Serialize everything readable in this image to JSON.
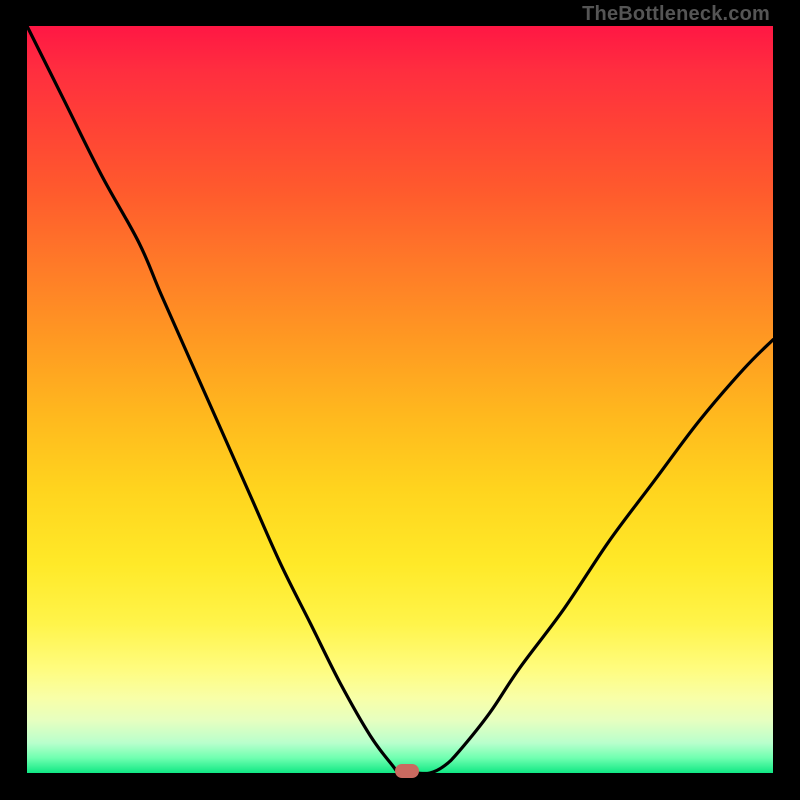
{
  "attribution": "TheBottleneck.com",
  "colors": {
    "frame": "#000000",
    "gradient_top": "#ff1744",
    "gradient_bottom": "#10e884",
    "curve": "#000000",
    "marker": "#c96a60",
    "attribution_text": "#555555"
  },
  "chart_data": {
    "type": "line",
    "title": "",
    "xlabel": "",
    "ylabel": "",
    "x": [
      0.0,
      0.05,
      0.1,
      0.15,
      0.18,
      0.22,
      0.26,
      0.3,
      0.34,
      0.38,
      0.42,
      0.46,
      0.49,
      0.5,
      0.52,
      0.54,
      0.56,
      0.58,
      0.62,
      0.66,
      0.72,
      0.78,
      0.84,
      0.9,
      0.96,
      1.0
    ],
    "values": [
      1.0,
      0.9,
      0.8,
      0.71,
      0.64,
      0.55,
      0.46,
      0.37,
      0.28,
      0.2,
      0.12,
      0.05,
      0.01,
      0.0,
      0.0,
      0.0,
      0.01,
      0.03,
      0.08,
      0.14,
      0.22,
      0.31,
      0.39,
      0.47,
      0.54,
      0.58
    ],
    "xlim": [
      0,
      1
    ],
    "ylim": [
      0,
      1
    ],
    "annotations": [
      {
        "type": "marker",
        "x": 0.51,
        "y": 0.0,
        "shape": "rounded-rect"
      }
    ]
  }
}
